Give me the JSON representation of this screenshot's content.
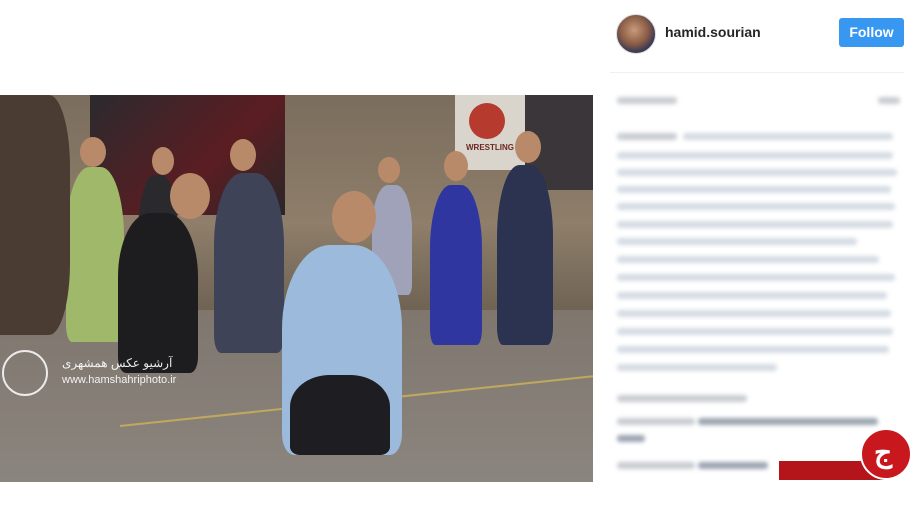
{
  "post": {
    "username": "hamid.sourian",
    "follow_label": "Follow"
  },
  "photo": {
    "watermark_line1": "آرشیو عکس همشهری",
    "watermark_line2": "www.hamshahriphoto.ir",
    "banner_text": "WRESTLING"
  },
  "site_logo": {
    "label": "باشگاه خبرنگاران"
  }
}
